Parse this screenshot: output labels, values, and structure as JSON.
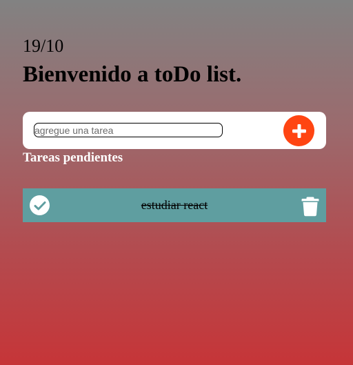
{
  "header": {
    "date": "19/10",
    "title": "Bienvenido a toDo list."
  },
  "add_task": {
    "value": "",
    "placeholder": "agregue una tarea",
    "button_icon": "plus-icon"
  },
  "section": {
    "pending_title": "Tareas pendientes"
  },
  "tasks": [
    {
      "text": "estudiar react",
      "completed": true,
      "check_icon": "check-icon",
      "delete_icon": "trash-icon"
    }
  ],
  "colors": {
    "accent": "#ff4512",
    "task_background": "#5f9ea0",
    "gradient_top": "#828282",
    "gradient_bottom": "#c63538"
  }
}
